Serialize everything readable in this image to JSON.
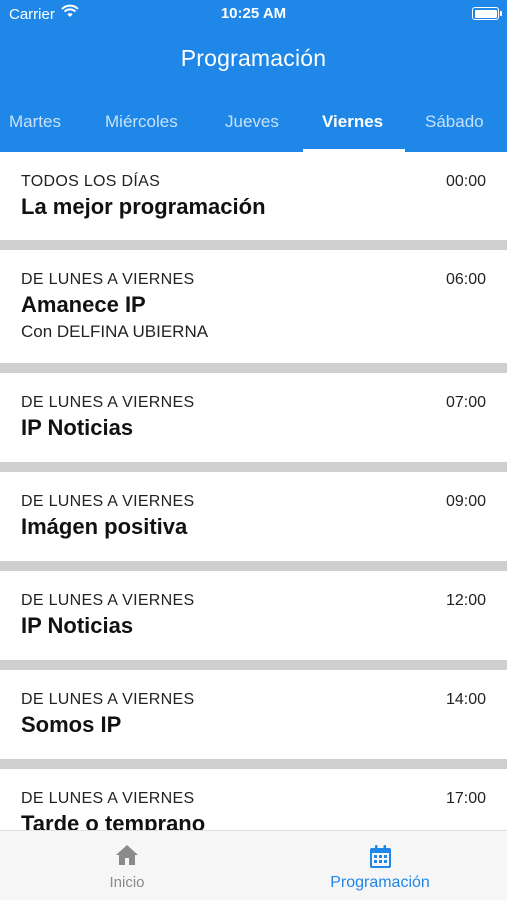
{
  "status_bar": {
    "carrier": "Carrier",
    "time": "10:25 AM"
  },
  "header": {
    "title": "Programación"
  },
  "tabs": [
    {
      "label": "Martes"
    },
    {
      "label": "Miércoles"
    },
    {
      "label": "Jueves"
    },
    {
      "label": "Viernes",
      "active": true
    },
    {
      "label": "Sábado"
    }
  ],
  "programs": [
    {
      "schedule": "TODOS LOS DÍAS",
      "time": "00:00",
      "title": "La mejor programación",
      "host": ""
    },
    {
      "schedule": "DE LUNES A VIERNES",
      "time": "06:00",
      "title": "Amanece IP",
      "host": "Con DELFINA UBIERNA"
    },
    {
      "schedule": "DE LUNES A VIERNES",
      "time": "07:00",
      "title": "IP Noticias",
      "host": ""
    },
    {
      "schedule": "DE LUNES A VIERNES",
      "time": "09:00",
      "title": "Imágen positiva",
      "host": ""
    },
    {
      "schedule": "DE LUNES A VIERNES",
      "time": "12:00",
      "title": "IP Noticias",
      "host": ""
    },
    {
      "schedule": "DE LUNES A VIERNES",
      "time": "14:00",
      "title": "Somos IP",
      "host": ""
    },
    {
      "schedule": "DE LUNES A VIERNES",
      "time": "17:00",
      "title": "Tarde o temprano",
      "host": ""
    }
  ],
  "bottom_nav": [
    {
      "label": "Inicio",
      "icon": "home-icon",
      "active": false
    },
    {
      "label": "Programación",
      "icon": "calendar-icon",
      "active": true
    }
  ],
  "colors": {
    "primary": "#1f87e8",
    "separator": "#cfcfcf",
    "nav_inactive": "#8a8a8a"
  }
}
